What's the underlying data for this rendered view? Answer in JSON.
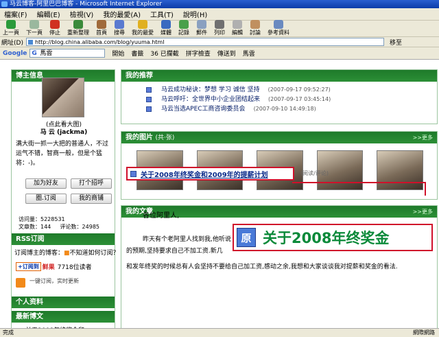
{
  "window": {
    "title": "马云博客-阿里巴巴博客 - Microsoft Internet Explorer"
  },
  "menu": [
    "檔案(F)",
    "編輯(E)",
    "檢視(V)",
    "我的最愛(A)",
    "工具(T)",
    "說明(H)"
  ],
  "toolbar": [
    "上一頁",
    "下一頁",
    "停止",
    "重新整理",
    "首頁",
    "搜尋",
    "我的最愛",
    "媒體",
    "記錄",
    "郵件",
    "列印",
    "編輯",
    "討論",
    "參考資料"
  ],
  "address": {
    "label": "網址(D)",
    "url": "http://blog.china.alibaba.com/blog/yuuma.html",
    "go": "移至"
  },
  "google": {
    "logo": "Google",
    "query": "馬雲",
    "items": [
      "開始",
      "書籤",
      "36 已攔截",
      "拼字檢查",
      "傳送到",
      "馬雲"
    ]
  },
  "left": {
    "header": "博主信息",
    "portrait_link": "(点此看大图)",
    "name": "马 云 (jackma)",
    "bio": "满大街一抓一大把的普通人，不过运气不错，智商一般，但是个猛将：-)。",
    "buttons": [
      "加为好友",
      "打个招呼",
      "圈.订阅",
      "我的商铺"
    ],
    "visits": "访问量：5228531",
    "articles": "文章数：144",
    "comments": "评论数：24985",
    "rss_header": "RSS订阅",
    "rss_q": "订阅博主的博客：",
    "rss_help": "不知道如何订阅？",
    "rss_btn": "+订阅到",
    "rss_btn2": "鲜果",
    "rss_cnt": "7718位读者",
    "rss_foot": "一键订阅，实时更新",
    "profile_header": "个人资料",
    "latest_header": "最新博文",
    "latest_item": "• 关于2008年终奖金和..."
  },
  "right": {
    "rec_header": "我的推荐",
    "recs": [
      {
        "title": "马云成功秘诀：梦想 学习 诚信 坚持",
        "date": "(2007-09-17 09:52:27)"
      },
      {
        "title": "马云呼吁：全世界中小企业团结起来",
        "date": "(2007-09-17 03:45:14)"
      },
      {
        "title": "马云当选APEC工商咨询委员会",
        "date": "(2007-09-10 14:49:18)"
      }
    ],
    "photos_header": "我的图片",
    "photos_count": "(共·张)",
    "photos_more": ">>更多",
    "articles_header": "我的文章",
    "articles_more": ">>更多",
    "article_title": "关于2008年终奖金和2009年的提薪计划",
    "article_tail": "(阅读/评论)",
    "salute": "各位阿里人,",
    "p1": "昨天有个老阿里人找到我,他听说",
    "p1b": "的预期,坚持要求自己不加工资.新几",
    "p2": "和发年终奖的时候总有人会坚持不要给自己加工资,感动之余,我想和大家谈谈我对提薪和奖金的看法.",
    "zoom_icon": "原",
    "zoom_text": "关于2008年终奖金"
  },
  "status": {
    "left": "完成",
    "right": "網際網路"
  }
}
